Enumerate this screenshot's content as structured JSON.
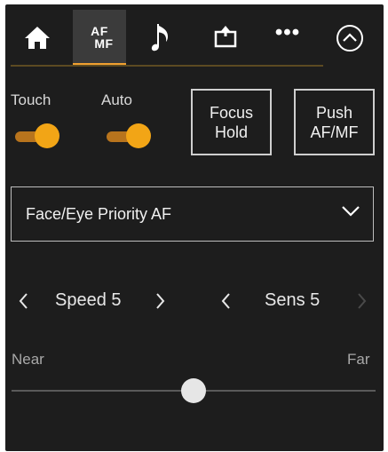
{
  "tabs": [
    {
      "icon": "home-icon",
      "label": ""
    },
    {
      "icon": "af-mf-icon",
      "label_line1": "AF",
      "label_line2": "MF",
      "active": true
    },
    {
      "icon": "music-note-icon",
      "label": ""
    },
    {
      "icon": "media-eject-icon",
      "label": ""
    },
    {
      "icon": "more-icon",
      "label": "•••"
    }
  ],
  "collapse": {
    "icon": "chevron-up-circle-icon"
  },
  "toggles": {
    "touch": {
      "label": "Touch",
      "on": true
    },
    "auto": {
      "label": "Auto",
      "on": true
    }
  },
  "buttons": {
    "focus_hold": {
      "line1": "Focus",
      "line2": "Hold"
    },
    "push_afmf": {
      "line1": "Push",
      "line2": "AF/MF"
    }
  },
  "dropdown": {
    "value": "Face/Eye Priority AF"
  },
  "speed": {
    "label": "Speed 5"
  },
  "sens": {
    "label": "Sens 5"
  },
  "focus_slider": {
    "near_label": "Near",
    "far_label": "Far",
    "position": 0.5
  },
  "colors": {
    "accent": "#f2a516",
    "panel": "#1d1d1d"
  }
}
